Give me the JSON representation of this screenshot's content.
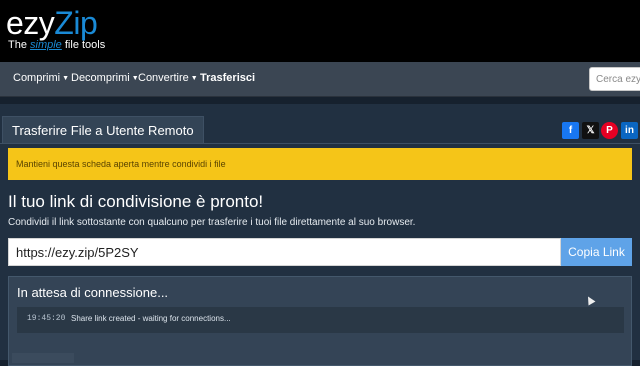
{
  "brand": {
    "logo_part1": "ezy",
    "logo_part2": "Zip",
    "tagline_pre": "The ",
    "tagline_simple": "simple",
    "tagline_post": " file tools"
  },
  "nav": {
    "items": [
      {
        "label": "Comprimi",
        "dropdown": true
      },
      {
        "label": "Decomprimi",
        "dropdown": true
      },
      {
        "label": "Convertire",
        "dropdown": true
      },
      {
        "label": "Trasferisci",
        "dropdown": false
      }
    ],
    "search_placeholder": "Cerca ezyZ"
  },
  "tab": {
    "label": "Trasferire File a Utente Remoto"
  },
  "share_buttons": [
    {
      "name": "facebook-icon",
      "glyph": "f",
      "color": "#1877f2"
    },
    {
      "name": "x-icon",
      "glyph": "𝕏",
      "color": "#111111"
    },
    {
      "name": "pinterest-icon",
      "glyph": "P",
      "color": "#e60023"
    },
    {
      "name": "linkedin-icon",
      "glyph": "in",
      "color": "#0a66c2"
    }
  ],
  "alert": {
    "text": "Mantieni questa scheda aperta mentre condividi i file"
  },
  "main": {
    "heading": "Il tuo link di condivisione è pronto!",
    "subtext": "Condividi il link sottostante con qualcuno per trasferire i tuoi file direttamente al suo browser.",
    "link_value": "https://ezy.zip/5P2SY",
    "copy_label": "Copia Link"
  },
  "connection": {
    "title": "In attesa di connessione...",
    "log": [
      {
        "time": "19:45:20",
        "message": "Share link created - waiting for connections..."
      }
    ]
  },
  "colors": {
    "accent": "#1a8ad6",
    "alert_bg": "#f5c518",
    "copy_button": "#5fa3e8"
  }
}
